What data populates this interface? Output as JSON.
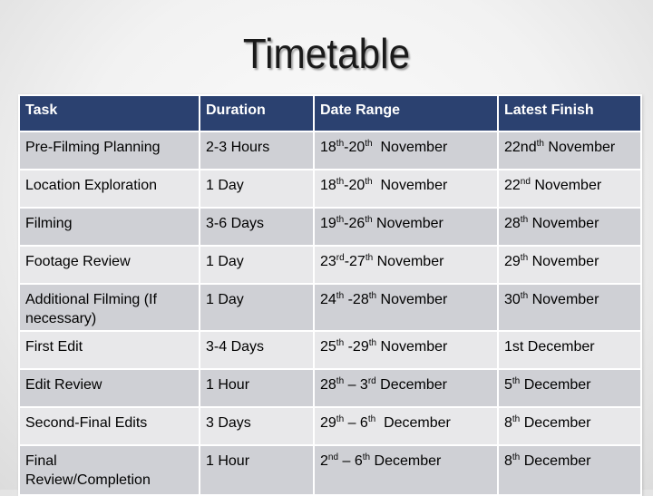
{
  "title": "Timetable",
  "colors": {
    "header_bg": "#2b4170",
    "row_dark": "#cfd0d5",
    "row_light": "#e8e8ea"
  },
  "table": {
    "headers": [
      "Task",
      "Duration",
      "Date Range",
      "Latest Finish"
    ],
    "rows": [
      {
        "task": "Pre-Filming Planning",
        "duration": "2-3 Hours",
        "date_range": [
          [
            "18",
            "th"
          ],
          [
            "-20",
            "th"
          ],
          [
            "  November",
            ""
          ]
        ],
        "latest_finish": [
          [
            "22nd",
            "th"
          ],
          [
            " November",
            ""
          ]
        ]
      },
      {
        "task": "Location Exploration",
        "duration": "1 Day",
        "date_range": [
          [
            "18",
            "th"
          ],
          [
            "-20",
            "th"
          ],
          [
            "  November",
            ""
          ]
        ],
        "latest_finish": [
          [
            "22",
            "nd"
          ],
          [
            " November",
            ""
          ]
        ]
      },
      {
        "task": "Filming",
        "duration": "3-6 Days",
        "date_range": [
          [
            "19",
            "th"
          ],
          [
            "-26",
            "th"
          ],
          [
            " November",
            ""
          ]
        ],
        "latest_finish": [
          [
            "28",
            "th"
          ],
          [
            " November",
            ""
          ]
        ]
      },
      {
        "task": "Footage Review",
        "duration": "1 Day",
        "date_range": [
          [
            "23",
            "rd"
          ],
          [
            "-27",
            "th"
          ],
          [
            " November",
            ""
          ]
        ],
        "latest_finish": [
          [
            "29",
            "th"
          ],
          [
            " November",
            ""
          ]
        ]
      },
      {
        "task": "Additional Filming (If necessary)",
        "duration": "1 Day",
        "date_range": [
          [
            "24",
            "th"
          ],
          [
            " -28",
            "th"
          ],
          [
            " November",
            ""
          ]
        ],
        "latest_finish": [
          [
            "30",
            "th"
          ],
          [
            " November",
            ""
          ]
        ]
      },
      {
        "task": "First Edit",
        "duration": "3-4 Days",
        "date_range": [
          [
            "25",
            "th"
          ],
          [
            " -29",
            "th"
          ],
          [
            " November",
            ""
          ]
        ],
        "latest_finish": [
          [
            "1st December",
            ""
          ]
        ]
      },
      {
        "task": "Edit Review",
        "duration": "1 Hour",
        "date_range": [
          [
            "28",
            "th"
          ],
          [
            " – 3",
            "rd"
          ],
          [
            " December",
            ""
          ]
        ],
        "latest_finish": [
          [
            "5",
            "th"
          ],
          [
            " December",
            ""
          ]
        ]
      },
      {
        "task": "Second-Final Edits",
        "duration": "3 Days",
        "date_range": [
          [
            "29",
            "th"
          ],
          [
            " – 6",
            "th"
          ],
          [
            "  December",
            ""
          ]
        ],
        "latest_finish": [
          [
            "8",
            "th"
          ],
          [
            " December",
            ""
          ]
        ]
      },
      {
        "task": "Final Review/Completion",
        "duration": "1 Hour",
        "date_range": [
          [
            "2",
            "nd"
          ],
          [
            " – 6",
            "th"
          ],
          [
            " December",
            ""
          ]
        ],
        "latest_finish": [
          [
            "8",
            "th"
          ],
          [
            " December",
            ""
          ]
        ]
      }
    ]
  }
}
